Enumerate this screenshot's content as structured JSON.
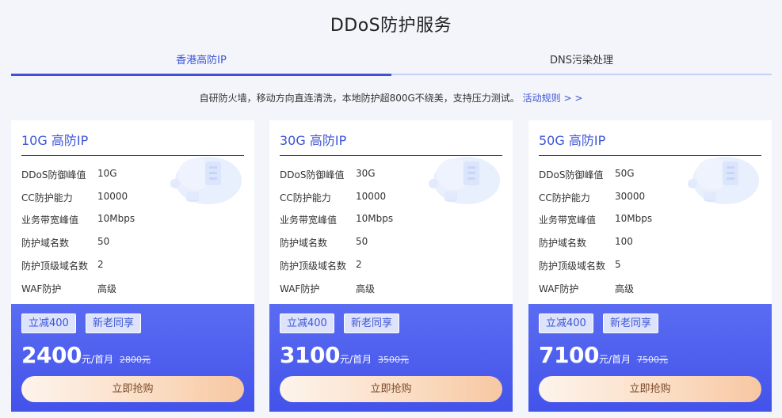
{
  "page": {
    "title": "DDoS防护服务"
  },
  "tabs": [
    {
      "label": "香港高防IP",
      "active": true
    },
    {
      "label": "DNS污染处理",
      "active": false
    }
  ],
  "promo": {
    "text": "自研防火墙，移动方向直连清洗，本地防护超800G不绕美，支持压力测试。",
    "link": "活动规则 > >"
  },
  "colors": {
    "accent": "#3d55d6",
    "card_bottom": "#4a5ced",
    "buy_button": "#fbdcc2"
  },
  "cards": [
    {
      "name": "10G 高防IP",
      "specs": [
        {
          "label": "DDoS防御峰值",
          "value": "10G"
        },
        {
          "label": "CC防护能力",
          "value": "10000"
        },
        {
          "label": "业务带宽峰值",
          "value": "10Mbps"
        },
        {
          "label": "防护域名数",
          "value": "50"
        },
        {
          "label": "防护顶级域名数",
          "value": "2"
        },
        {
          "label": "WAF防护",
          "value": "高级"
        }
      ],
      "badges": [
        "立减400",
        "新老同享"
      ],
      "price": "2400",
      "price_unit": "元/首月",
      "original_price": "2800元",
      "buy_label": "立即抢购"
    },
    {
      "name": "30G 高防IP",
      "specs": [
        {
          "label": "DDoS防御峰值",
          "value": "30G"
        },
        {
          "label": "CC防护能力",
          "value": "10000"
        },
        {
          "label": "业务带宽峰值",
          "value": "10Mbps"
        },
        {
          "label": "防护域名数",
          "value": "50"
        },
        {
          "label": "防护顶级域名数",
          "value": "2"
        },
        {
          "label": "WAF防护",
          "value": "高级"
        }
      ],
      "badges": [
        "立减400",
        "新老同享"
      ],
      "price": "3100",
      "price_unit": "元/首月",
      "original_price": "3500元",
      "buy_label": "立即抢购"
    },
    {
      "name": "50G 高防IP",
      "specs": [
        {
          "label": "DDoS防御峰值",
          "value": "50G"
        },
        {
          "label": "CC防护能力",
          "value": "30000"
        },
        {
          "label": "业务带宽峰值",
          "value": "10Mbps"
        },
        {
          "label": "防护域名数",
          "value": "100"
        },
        {
          "label": "防护顶级域名数",
          "value": "5"
        },
        {
          "label": "WAF防护",
          "value": "高级"
        }
      ],
      "badges": [
        "立减400",
        "新老同享"
      ],
      "price": "7100",
      "price_unit": "元/首月",
      "original_price": "7500元",
      "buy_label": "立即抢购"
    }
  ]
}
